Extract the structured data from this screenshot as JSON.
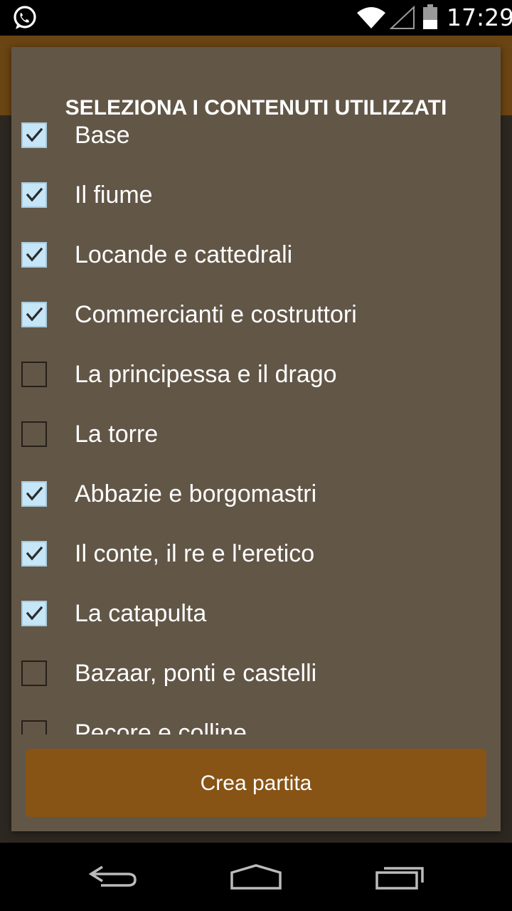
{
  "status_bar": {
    "time": "17:29",
    "icons": [
      "whatsapp-icon",
      "wifi-icon",
      "signal-icon",
      "battery-icon"
    ]
  },
  "dialog": {
    "title": "SELEZIONA I CONTENUTI UTILIZZATI",
    "items": [
      {
        "label": "Base",
        "checked": true
      },
      {
        "label": "Il fiume",
        "checked": true
      },
      {
        "label": "Locande e cattedrali",
        "checked": true
      },
      {
        "label": "Commercianti e costruttori",
        "checked": true
      },
      {
        "label": "La principessa e il drago",
        "checked": false
      },
      {
        "label": "La torre",
        "checked": false
      },
      {
        "label": "Abbazie e borgomastri",
        "checked": true
      },
      {
        "label": "Il conte, il re e l'eretico",
        "checked": true
      },
      {
        "label": "La catapulta",
        "checked": true
      },
      {
        "label": "Bazaar, ponti e castelli",
        "checked": false
      },
      {
        "label": "Pecore e colline",
        "checked": false
      }
    ],
    "button_label": "Crea partita"
  },
  "nav_bar": {
    "icons": [
      "back-icon",
      "home-icon",
      "recents-icon"
    ]
  },
  "colors": {
    "dialog_bg": "#625647",
    "button_bg": "#875416",
    "checkbox_checked": "#c5e6f7"
  }
}
